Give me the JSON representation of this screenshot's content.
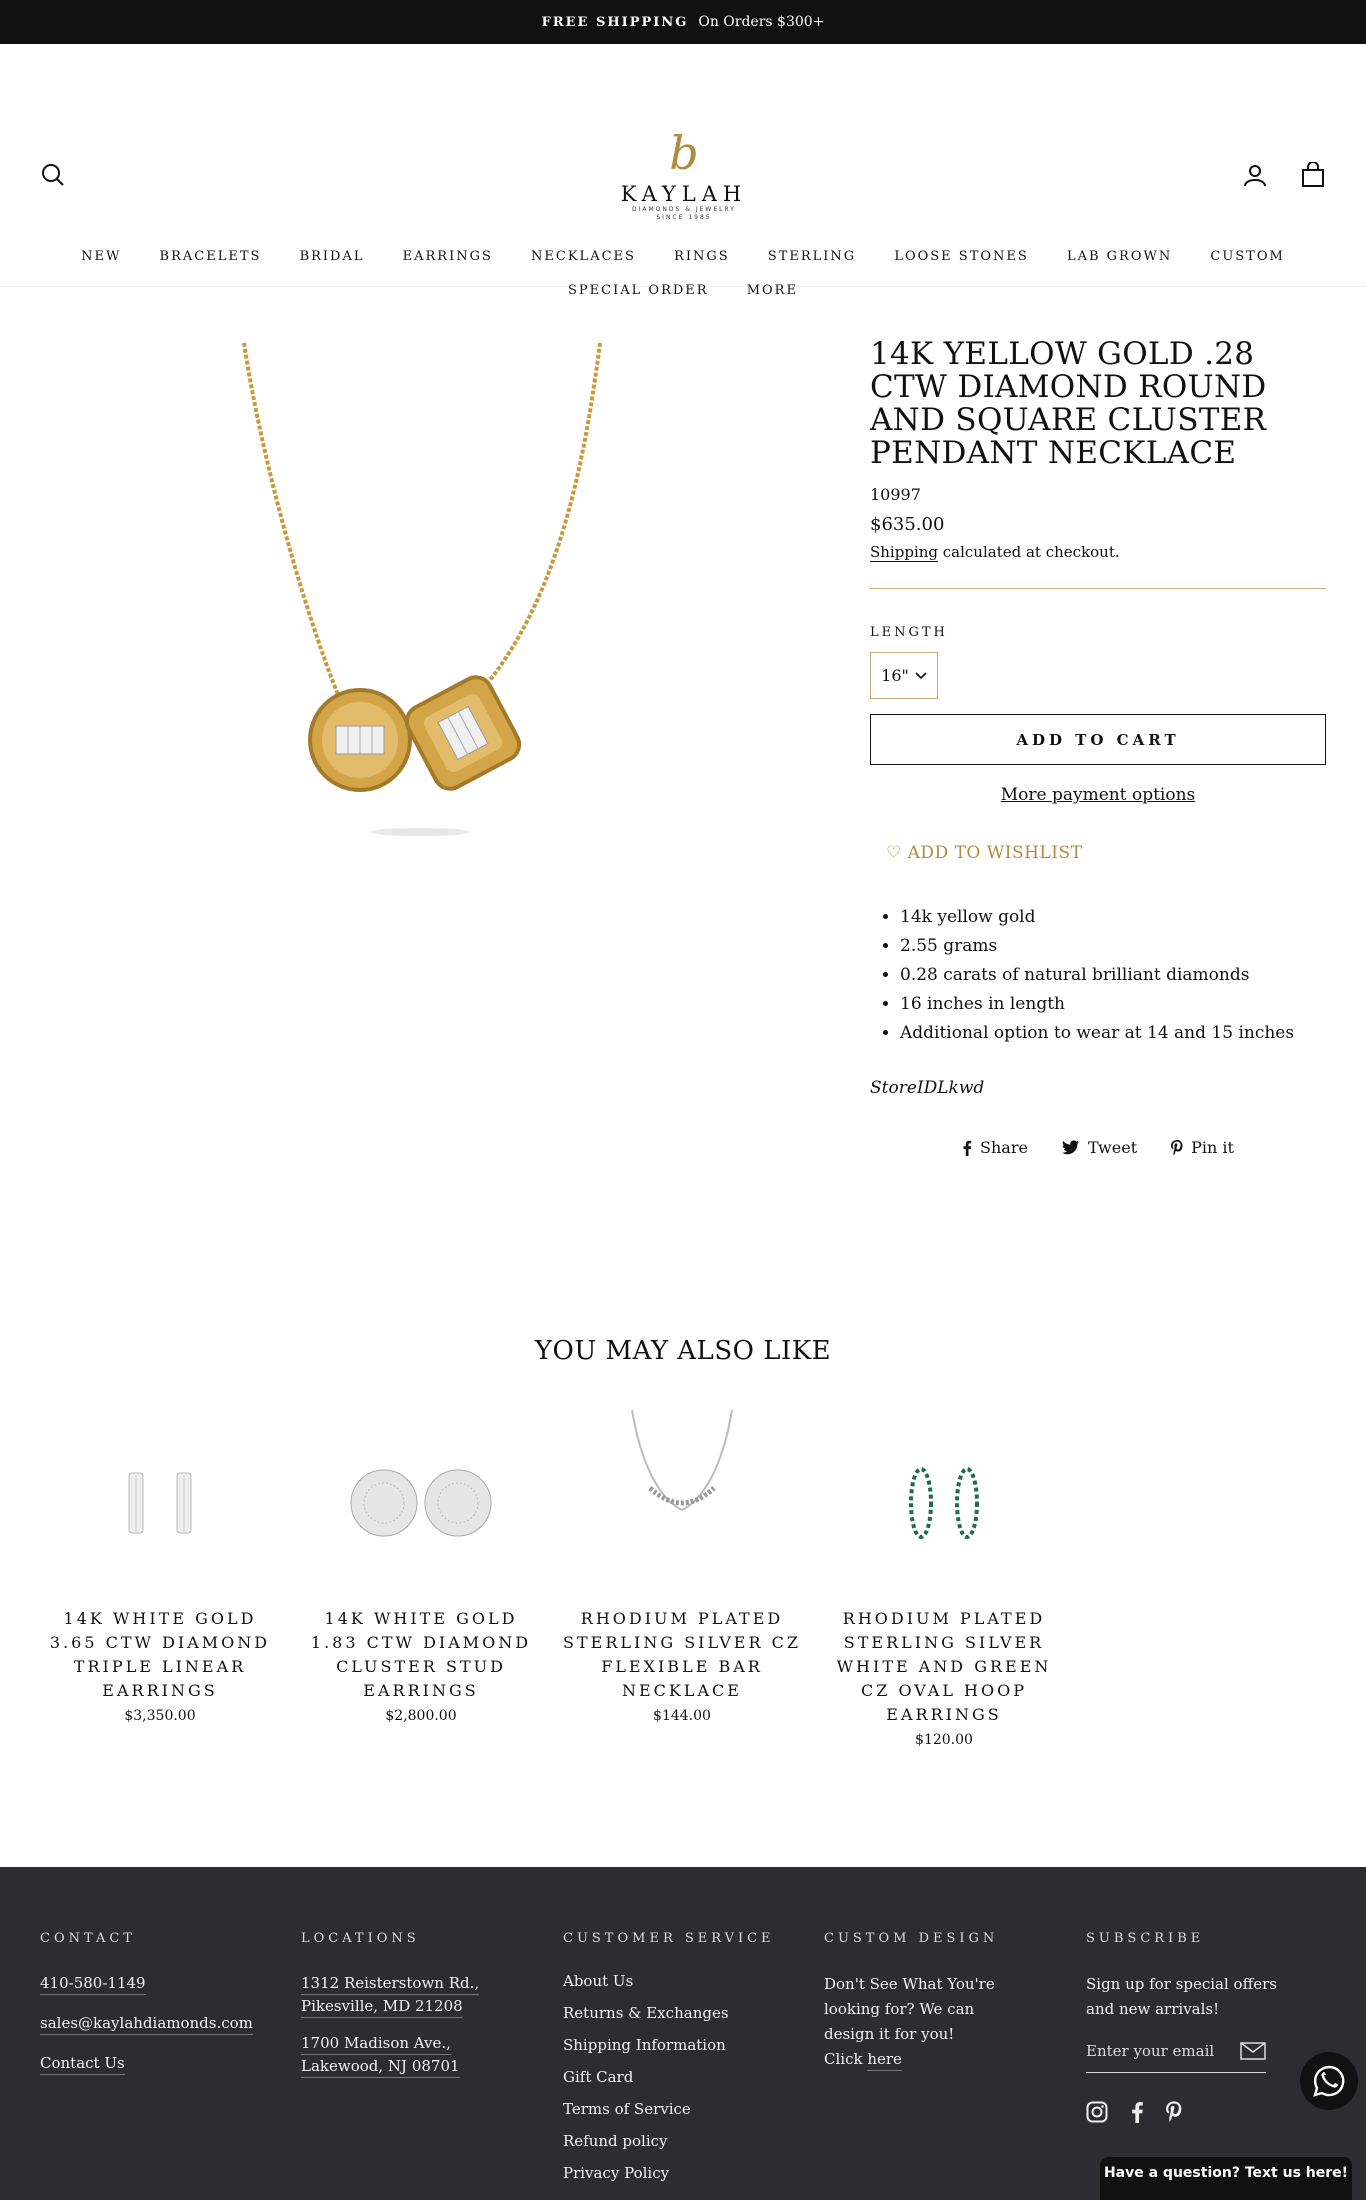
{
  "announcement": {
    "strong": "FREE SHIPPING",
    "text": "On Orders $300+"
  },
  "header": {
    "logo_mark": "b",
    "logo_name": "KAYLAH",
    "logo_sub": "DIAMONDS & JEWELRY",
    "logo_since": "SINCE 1985",
    "icons": [
      "search-icon",
      "user-icon",
      "cart-icon"
    ]
  },
  "nav": {
    "row1": [
      "NEW",
      "BRACELETS",
      "BRIDAL",
      "EARRINGS",
      "NECKLACES",
      "RINGS",
      "STERLING",
      "LOOSE STONES",
      "LAB GROWN",
      "CUSTOM"
    ],
    "row2": [
      "SPECIAL ORDER",
      "MORE"
    ]
  },
  "product": {
    "title": "14K YELLOW GOLD .28 CTW DIAMOND ROUND AND SQUARE CLUSTER PENDANT NECKLACE",
    "sku": "10997",
    "price": "$635.00",
    "shipping_link": "Shipping",
    "shipping_rest": " calculated at checkout.",
    "length_label": "LENGTH",
    "length_value": "16\"",
    "add_to_cart": "ADD TO CART",
    "more_payment": "More payment options",
    "wishlist": "ADD TO WISHLIST",
    "bullets": [
      "14k yellow gold",
      "2.55 grams",
      "0.28 carats of natural brilliant diamonds",
      "16 inches in length",
      "Additional option to wear at 14 and 15 inches"
    ],
    "store_id": "StoreIDLkwd",
    "share": {
      "share": "Share",
      "tweet": "Tweet",
      "pin": "Pin it"
    }
  },
  "related": {
    "title": "YOU MAY ALSO LIKE",
    "items": [
      {
        "name": "14K WHITE GOLD 3.65 CTW DIAMOND TRIPLE LINEAR EARRINGS",
        "price": "$3,350.00"
      },
      {
        "name": "14K WHITE GOLD 1.83 CTW DIAMOND CLUSTER STUD EARRINGS",
        "price": "$2,800.00"
      },
      {
        "name": "RHODIUM PLATED STERLING SILVER CZ FLEXIBLE BAR NECKLACE",
        "price": "$144.00"
      },
      {
        "name": "RHODIUM PLATED STERLING SILVER WHITE AND GREEN CZ OVAL HOOP EARRINGS",
        "price": "$120.00"
      }
    ]
  },
  "footer": {
    "contact": {
      "heading": "CONTACT",
      "phone": "410-580-1149",
      "email": "sales@kaylahdiamonds.com",
      "contact_us": "Contact Us"
    },
    "locations": {
      "heading": "LOCATIONS",
      "loc1_line1": "1312 Reisterstown Rd.,",
      "loc1_line2": "Pikesville, MD 21208",
      "loc2_line1": "1700 Madison Ave.,",
      "loc2_line2": "Lakewood, NJ 08701"
    },
    "service": {
      "heading": "CUSTOMER SERVICE",
      "links": [
        "About Us",
        "Returns & Exchanges",
        "Shipping Information",
        "Gift Card",
        "Terms of Service",
        "Refund policy",
        "Privacy Policy"
      ]
    },
    "custom": {
      "heading": "CUSTOM DESIGN",
      "line1": "Don't See What You're",
      "line2": "looking for? We can",
      "line3": "design it for you!",
      "click_prefix": "Click ",
      "click_link": "here"
    },
    "subscribe": {
      "heading": "SUBSCRIBE",
      "line1": "Sign up for special offers",
      "line2": "and new arrivals!",
      "placeholder": "Enter your email"
    },
    "chat_tab": "Have a question? Text us here!"
  },
  "colors": {
    "accent_gold": "#b08a3e",
    "footer_bg": "#2d2c31",
    "announcement_bg": "#111111"
  }
}
